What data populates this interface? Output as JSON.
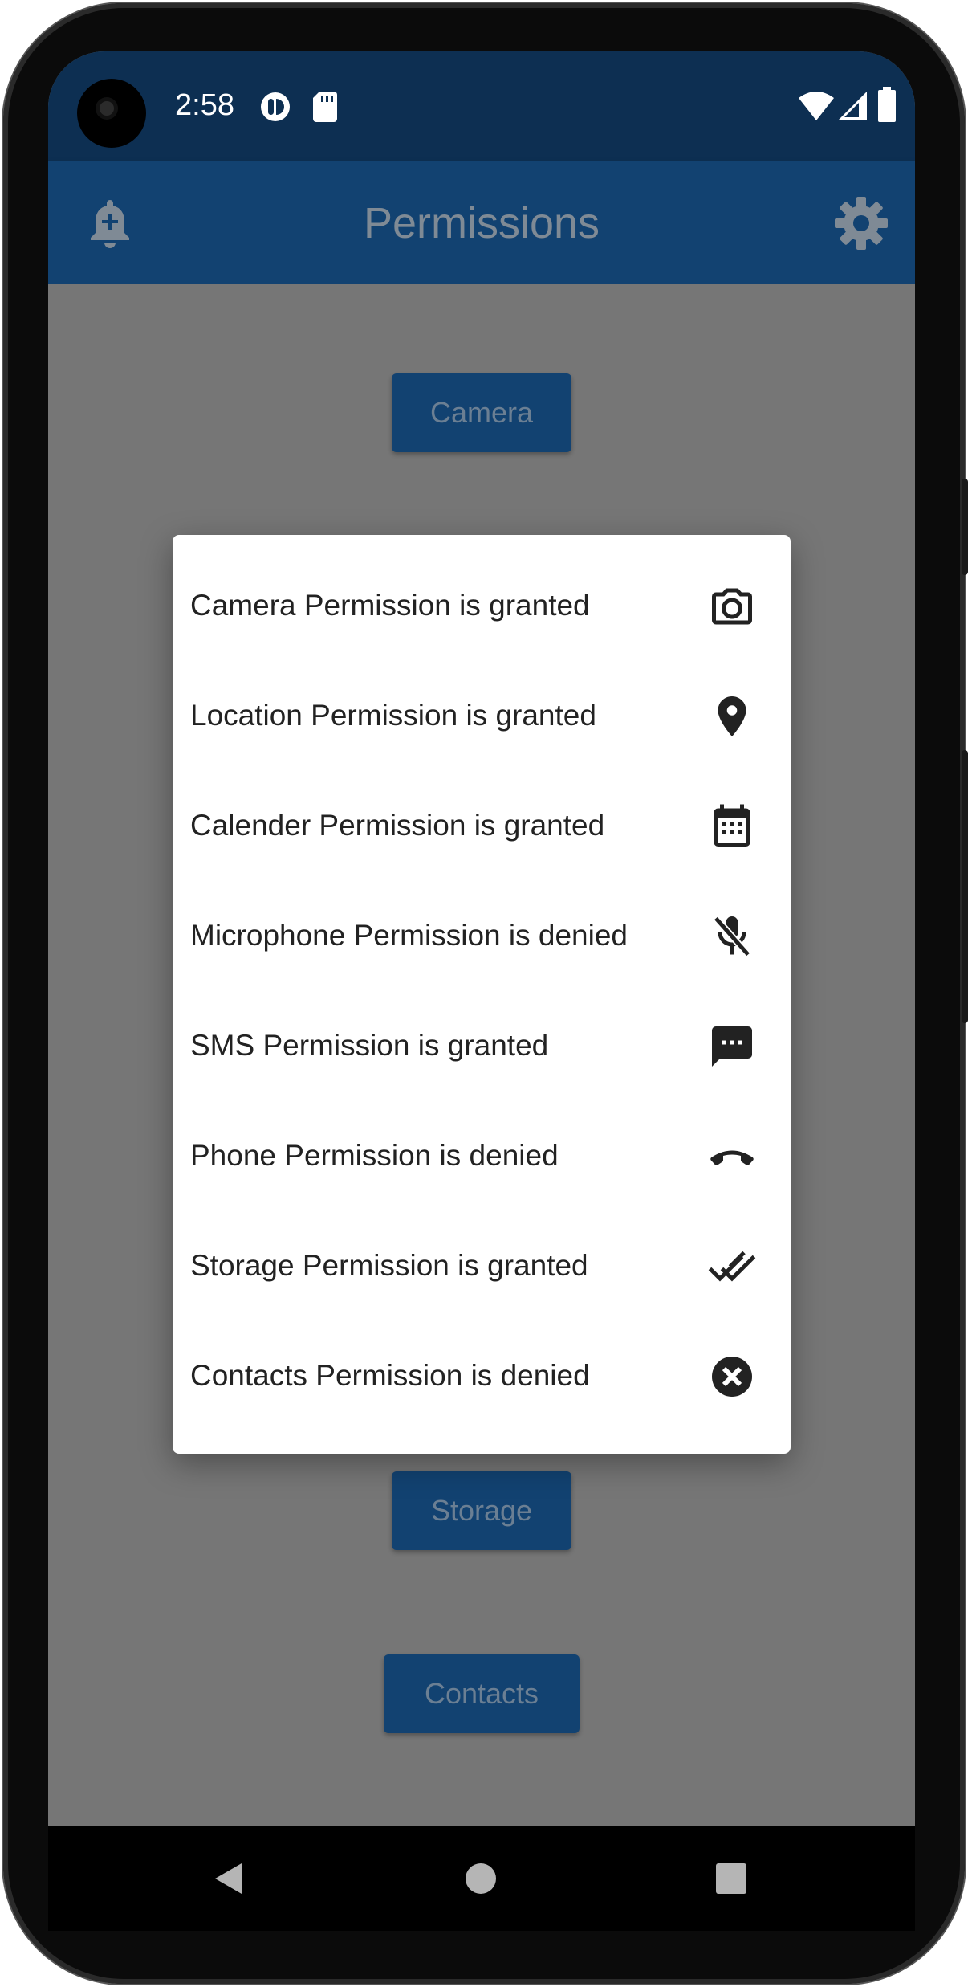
{
  "status_bar": {
    "time": "2:58"
  },
  "app_bar": {
    "title": "Permissions"
  },
  "background_buttons": {
    "camera": "Camera",
    "storage": "Storage",
    "contacts": "Contacts"
  },
  "dialog": {
    "items": [
      {
        "label": "Camera Permission is granted",
        "icon": "camera-icon"
      },
      {
        "label": "Location Permission is granted",
        "icon": "location-pin-icon"
      },
      {
        "label": "Calender Permission is granted",
        "icon": "calendar-icon"
      },
      {
        "label": "Microphone Permission is denied",
        "icon": "mic-off-icon"
      },
      {
        "label": "SMS Permission is granted",
        "icon": "sms-icon"
      },
      {
        "label": "Phone Permission is denied",
        "icon": "call-end-icon"
      },
      {
        "label": "Storage Permission is granted",
        "icon": "done-all-icon"
      },
      {
        "label": "Contacts Permission is denied",
        "icon": "cancel-icon"
      }
    ]
  },
  "colors": {
    "status_bar": "#0d2f52",
    "app_bar": "#124271",
    "scrim": "#767676",
    "dialog": "#ffffff"
  }
}
